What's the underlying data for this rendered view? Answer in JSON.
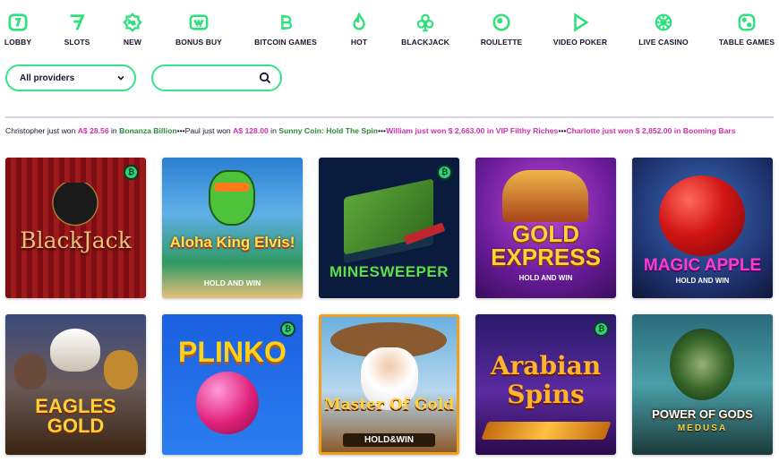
{
  "nav": {
    "items": [
      {
        "label": "LOBBY",
        "icon": "lobby-icon"
      },
      {
        "label": "SLOTS",
        "icon": "slots-seven-icon"
      },
      {
        "label": "NEW",
        "icon": "new-badge-icon"
      },
      {
        "label": "BONUS BUY",
        "icon": "bonus-buy-icon"
      },
      {
        "label": "BITCOIN GAMES",
        "icon": "bitcoin-icon"
      },
      {
        "label": "HOT",
        "icon": "flame-icon"
      },
      {
        "label": "BLACKJACK",
        "icon": "club-icon"
      },
      {
        "label": "ROULETTE",
        "icon": "roulette-icon"
      },
      {
        "label": "VIDEO POKER",
        "icon": "play-icon"
      },
      {
        "label": "LIVE CASINO",
        "icon": "live-casino-icon"
      },
      {
        "label": "TABLE GAMES",
        "icon": "dice-icon"
      }
    ]
  },
  "filters": {
    "provider_label": "All providers",
    "search_value": "",
    "search_placeholder": ""
  },
  "ticker": [
    {
      "user": "Christopher",
      "won": "just won",
      "amount": "A$ 28.56",
      "in": "in",
      "game": "Bonanza Billion"
    },
    {
      "user": "Paul",
      "won": "just won",
      "amount": "A$ 128.00",
      "in": "in",
      "game": "Sunny Coin: Hold The Spin"
    },
    {
      "user": "William",
      "won": "just won",
      "amount": "$ 2,663.00",
      "in": "in",
      "game": "VIP Filthy Riches"
    },
    {
      "user": "Charlotte",
      "won": "just won",
      "amount": "$ 2,852.00",
      "in": "in",
      "game": "Booming Bars"
    }
  ],
  "ticker_separator": "•••",
  "games": [
    {
      "title": "BlackJack",
      "subtitle": "",
      "bitcoin": true
    },
    {
      "title": "Aloha King Elvis!",
      "subtitle": "HOLD AND WIN",
      "bitcoin": false
    },
    {
      "title": "MINESWEEPER",
      "subtitle": "",
      "bitcoin": true
    },
    {
      "title": "GOLD EXPRESS",
      "subtitle": "HOLD AND WIN",
      "bitcoin": false
    },
    {
      "title": "MAGIC APPLE",
      "subtitle": "HOLD AND WIN",
      "bitcoin": false
    },
    {
      "title": "EAGLES GOLD",
      "subtitle": "",
      "bitcoin": false
    },
    {
      "title": "PLINKO",
      "subtitle": "",
      "bitcoin": true
    },
    {
      "title": "Master Of Gold",
      "subtitle": "HOLD&WIN",
      "bitcoin": false
    },
    {
      "title": "Arabian Spins",
      "subtitle": "",
      "bitcoin": true
    },
    {
      "title": "POWER OF GODS",
      "subtitle": "MEDUSA",
      "bitcoin": false
    }
  ],
  "bitcoin_badge_symbol": "₿",
  "colors": {
    "accent": "#2fe07d",
    "text": "#1c1230",
    "amount": "#d22fae",
    "game": "#2c8a3b"
  }
}
